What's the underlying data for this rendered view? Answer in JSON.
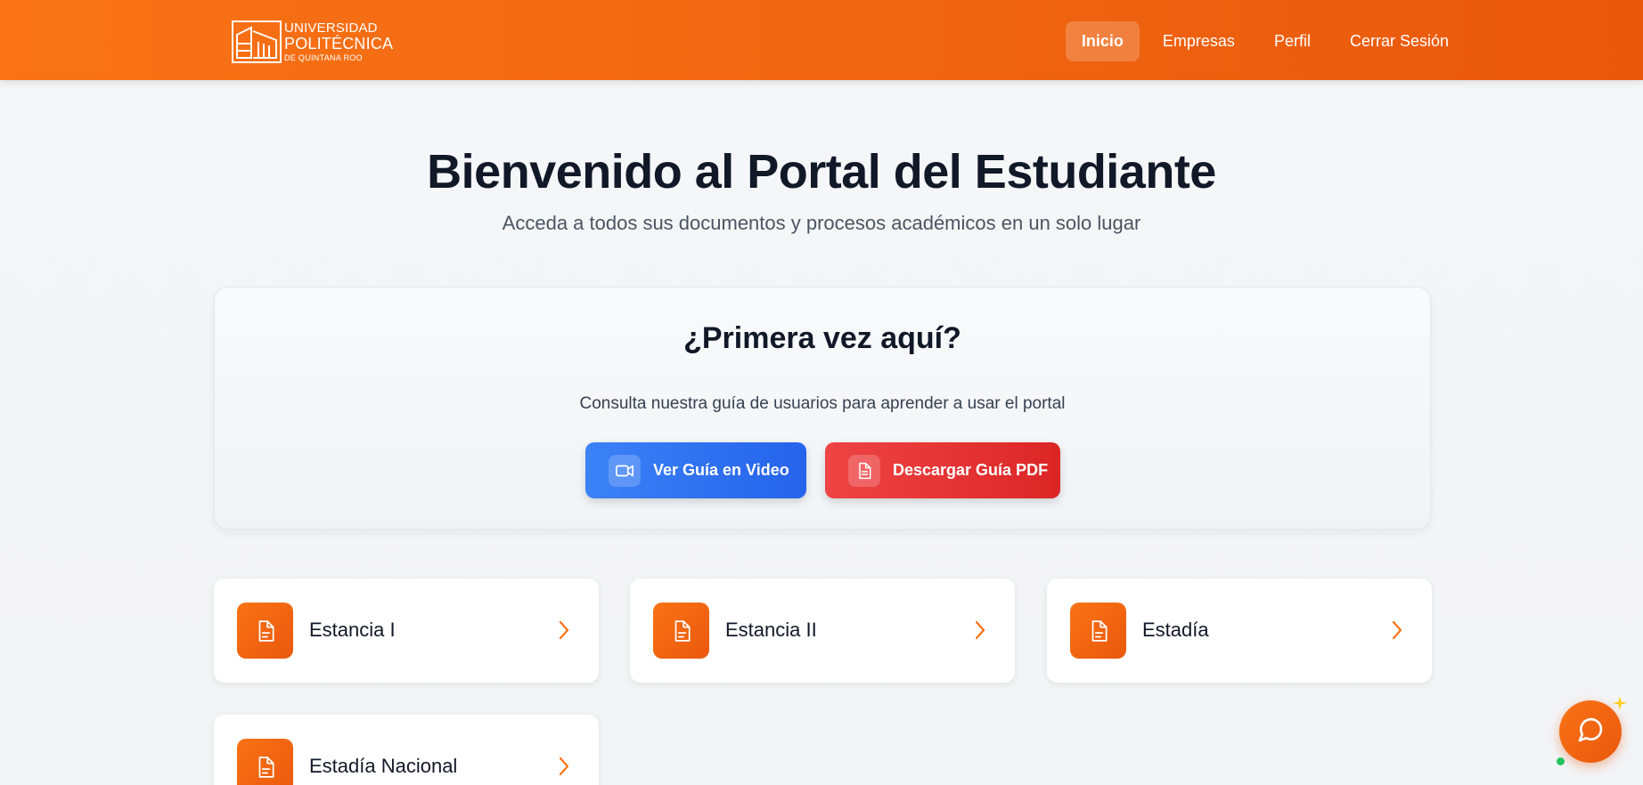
{
  "header": {
    "logo": {
      "line1": "UNIVERSIDAD",
      "line2": "POLITÉCNICA",
      "line3": "DE QUINTANA ROO"
    },
    "nav": [
      {
        "label": "Inicio",
        "active": true
      },
      {
        "label": "Empresas",
        "active": false
      },
      {
        "label": "Perfil",
        "active": false
      },
      {
        "label": "Cerrar Sesión",
        "active": false
      }
    ]
  },
  "hero": {
    "title": "Bienvenido al Portal del Estudiante",
    "subtitle": "Acceda a todos sus documentos y procesos académicos en un solo lugar"
  },
  "first_time": {
    "title": "¿Primera vez aquí?",
    "subtitle": "Consulta nuestra guía de usuarios para aprender a usar el portal",
    "video_button": {
      "label": "Ver Guía en Video",
      "icon": "video-camera-icon"
    },
    "pdf_button": {
      "label": "Descargar Guía PDF",
      "icon": "document-icon"
    }
  },
  "modules": [
    {
      "label": "Estancia I",
      "icon": "document-icon"
    },
    {
      "label": "Estancia II",
      "icon": "document-icon"
    },
    {
      "label": "Estadía",
      "icon": "document-icon"
    },
    {
      "label": "Estadía Nacional",
      "icon": "document-icon"
    }
  ],
  "chat": {
    "icon": "chat-bubble-icon",
    "status": "online"
  },
  "colors": {
    "brand": "#f97316",
    "brand_dark": "#ea580c",
    "video": "#3b82f6",
    "pdf": "#ef4444",
    "online": "#22c55e"
  }
}
